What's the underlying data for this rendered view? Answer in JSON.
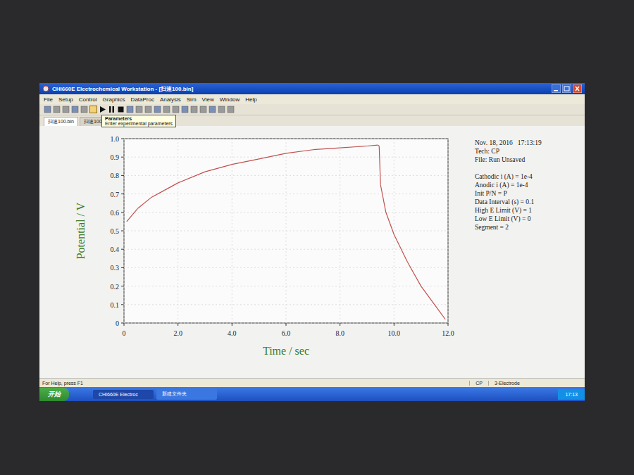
{
  "window": {
    "title": "CHI660E Electrochemical Workstation - [扫速100.bin]"
  },
  "menu": [
    "File",
    "Setup",
    "Control",
    "Graphics",
    "DataProc",
    "Analysis",
    "Sim",
    "View",
    "Window",
    "Help"
  ],
  "tooltip": {
    "title": "Parameters",
    "text": "Enter experimental parameters"
  },
  "tabs": [
    {
      "label": "扫速100.bin",
      "selected": true
    },
    {
      "label": "扫速1000.bin",
      "selected": false
    }
  ],
  "chart": {
    "y_axis": {
      "title": "Potential / V",
      "ticks": [
        "0",
        "0.1",
        "0.2",
        "0.3",
        "0.4",
        "0.5",
        "0.6",
        "0.7",
        "0.8",
        "0.9",
        "1.0"
      ]
    },
    "x_axis": {
      "title": "Time / sec",
      "ticks": [
        "0",
        "2.0",
        "4.0",
        "6.0",
        "8.0",
        "10.0",
        "12.0"
      ]
    },
    "series": [
      {
        "times": [
          0.1,
          0.5,
          1,
          1.5,
          2,
          3,
          4,
          5,
          6,
          7,
          8,
          9,
          9.4,
          9.45,
          9.5,
          9.7,
          10,
          10.5,
          11,
          11.5,
          11.9
        ],
        "values": [
          0.55,
          0.62,
          0.68,
          0.72,
          0.76,
          0.82,
          0.86,
          0.89,
          0.92,
          0.94,
          0.95,
          0.96,
          0.965,
          0.96,
          0.75,
          0.6,
          0.48,
          0.33,
          0.2,
          0.1,
          0.02
        ]
      }
    ]
  },
  "info": [
    "Nov. 18, 2016   17:13:19",
    "Tech: CP",
    "File: Run Unsaved",
    "",
    "Cathodic i (A) = 1e-4",
    "Anodic i (A) = 1e-4",
    "Init P/N = P",
    "Data Interval (s) = 0.1",
    "High E Limit (V) = 1",
    "Low E Limit (V) = 0",
    "Segment = 2"
  ],
  "status_bar": {
    "help": "For Help, press F1",
    "mode": "CP",
    "electrode": "3-Electrode"
  },
  "taskbar": {
    "start": "开始",
    "items": [
      {
        "label": "CHI660E Electroc",
        "selected": true
      },
      {
        "label": "新建文件夹",
        "selected": false
      }
    ],
    "clock": "17:13"
  }
}
